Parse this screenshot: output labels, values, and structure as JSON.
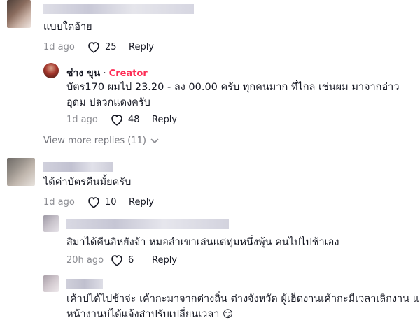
{
  "comments": [
    {
      "text_lines": [
        "แบบใดอ้าย"
      ],
      "time": "1d ago",
      "likes": "25",
      "reply_label": "Reply"
    },
    {
      "username": "ช่าง ขุน",
      "dot": "·",
      "badge": "Creator",
      "text_lines": [
        "บัตร170 ผมไป 23.20 - ลง 00.00 ครับ ทุกคนมาก ที่ไกล เช่นผม มาจากอ่าว",
        "อุดม ปลวกแดงครับ"
      ],
      "time": "1d ago",
      "likes": "48",
      "reply_label": "Reply"
    },
    {
      "text_lines": [
        "ได้ค่าบัตรคืนมั้ยครับ"
      ],
      "time": "1d ago",
      "likes": "10",
      "reply_label": "Reply"
    },
    {
      "text_lines": [
        "สิมาได้คืนอิหยังจ้า หมอลำเขาเล่นแต่ทุ่มหนึ่งพุ้น คนไปไปช้าเอง"
      ],
      "time": "20h ago",
      "likes": "6",
      "reply_label": "Reply"
    },
    {
      "text_lines": [
        "เค้าบ่ได้ไปช้าจ่ะ เค้ากะมาจากต่างถิ่น ต่างจังหวัด ผู้เฮ็ดงานเค้ากะมีเวลาเลิกงาน แต่",
        "หน้างานบ่ได้แจ้งส่าปรับเปลี่ยนเวลา 😏"
      ]
    }
  ],
  "view_more_label": "View more replies (11)",
  "colors": {
    "creator": "#fe2c55",
    "text": "#161823",
    "muted": "#8a8b91"
  },
  "icons": [
    "heart-outline-icon",
    "chevron-down-icon"
  ]
}
